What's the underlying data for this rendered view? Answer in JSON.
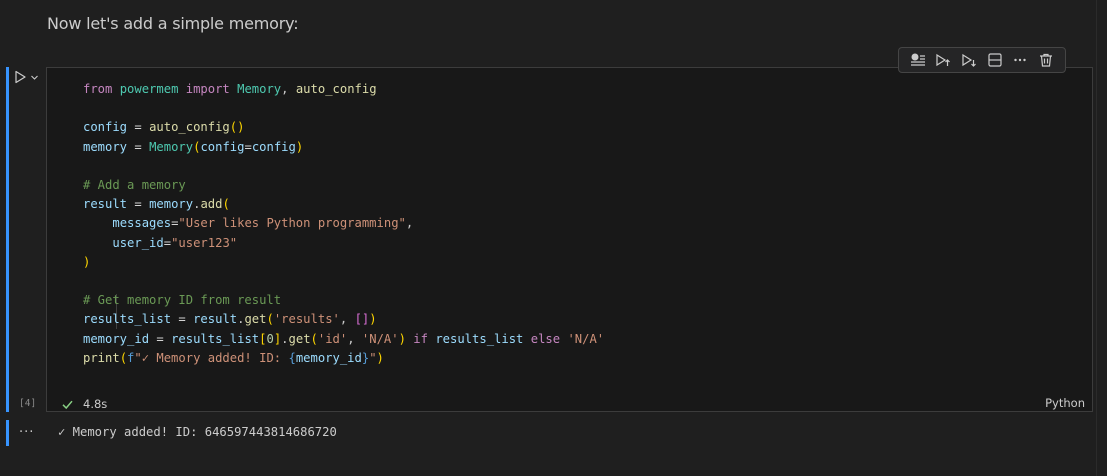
{
  "markdown": {
    "text": "Now let's add a simple memory:"
  },
  "cell": {
    "execution_count": "[4]",
    "status_time": "4.8s",
    "language": "Python",
    "code": {
      "l1": [
        "from",
        "powermem",
        "import",
        "Memory",
        ",",
        "auto_config"
      ],
      "l3": [
        "config",
        "=",
        "auto_config",
        "()"
      ],
      "l4": [
        "memory",
        "=",
        "Memory",
        "(",
        "config",
        "=",
        "config",
        ")"
      ],
      "l6": [
        "# Add a memory"
      ],
      "l7": [
        "result",
        "=",
        "memory",
        ".",
        "add",
        "("
      ],
      "l8": [
        "messages",
        "=",
        "\"User likes Python programming\"",
        ","
      ],
      "l9": [
        "user_id",
        "=",
        "\"user123\""
      ],
      "l10": [
        ")"
      ],
      "l12": [
        "# Get memory ID from result"
      ],
      "l13": [
        "results_list",
        "=",
        "result",
        ".",
        "get",
        "(",
        "'results'",
        ",",
        "[]",
        ")"
      ],
      "l14": [
        "memory_id",
        "=",
        "results_list",
        "[",
        "0",
        "]",
        ".",
        "get",
        "(",
        "'id'",
        ",",
        "'N/A'",
        ")",
        "if",
        "results_list",
        "else",
        "'N/A'"
      ],
      "l15": [
        "print",
        "(",
        "f",
        "\"✓ Memory added! ID: ",
        "{",
        "memory_id",
        "}",
        "\"",
        ")"
      ]
    }
  },
  "output": {
    "more": "···",
    "text": "✓ Memory added! ID: 646597443814686720"
  },
  "colors": {
    "accent": "#3794ff",
    "success": "#89d185",
    "background": "#1f1f1f",
    "cell_background": "#181818"
  }
}
